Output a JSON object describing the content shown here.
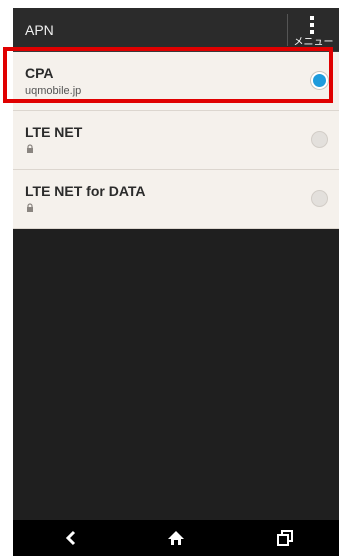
{
  "header": {
    "title": "APN",
    "menu_label": "メニュー"
  },
  "apn_list": [
    {
      "name": "CPA",
      "subtitle": "uqmobile.jp",
      "selected": true,
      "locked": false
    },
    {
      "name": "LTE NET",
      "subtitle": "",
      "selected": false,
      "locked": true
    },
    {
      "name": "LTE NET for DATA",
      "subtitle": "",
      "selected": false,
      "locked": true
    }
  ],
  "colors": {
    "radio_selected": "#1e9bdc",
    "highlight": "#e00000",
    "list_background": "#f5f1ec",
    "screen_background": "#1f1f1f"
  },
  "navbar": {
    "icons": [
      "back-icon",
      "home-icon",
      "recents-icon"
    ]
  }
}
